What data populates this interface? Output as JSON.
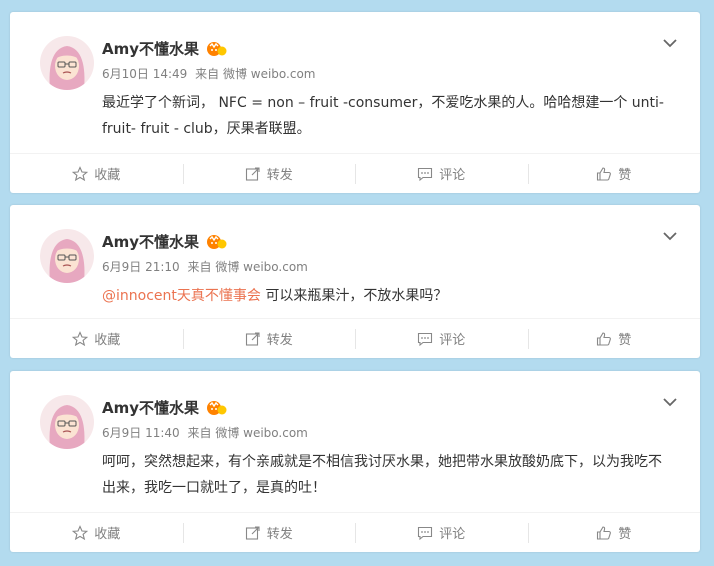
{
  "posts": [
    {
      "user": "Amy不懂水果",
      "date": "6月10日 14:49",
      "via": "来自 微博 weibo.com",
      "mention": "",
      "text": "最近学了个新词， NFC = non – fruit -consumer，不爱吃水果的人。哈哈想建一个 unti- fruit- fruit - club，厌果者联盟。"
    },
    {
      "user": "Amy不懂水果",
      "date": "6月9日 21:10",
      "via": "来自 微博 weibo.com",
      "mention": "@innocent天真不懂事会",
      "text": " 可以来瓶果汁，不放水果吗？"
    },
    {
      "user": "Amy不懂水果",
      "date": "6月9日 11:40",
      "via": "来自 微博 weibo.com",
      "mention": "",
      "text": "呵呵，突然想起来，有个亲戚就是不相信我讨厌水果，她把带水果放酸奶底下，以为我吃不出来，我吃一口就吐了，是真的吐！"
    }
  ],
  "actions": {
    "favorite": "收藏",
    "repost": "转发",
    "comment": "评论",
    "like": "赞"
  },
  "colors": {
    "background": "#b3dbef",
    "mention": "#eb7350",
    "badge": "#ff8200"
  },
  "icons": [
    "avatar",
    "vip-badge-icon",
    "chevron-down-icon",
    "star-icon",
    "repost-icon",
    "comment-icon",
    "like-icon"
  ]
}
